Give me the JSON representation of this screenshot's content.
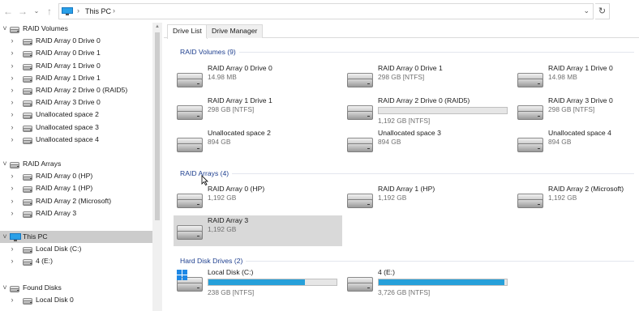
{
  "address_bar": {
    "path": "This PC",
    "back_icon": "arrow-left-icon",
    "forward_icon": "arrow-right-icon",
    "up_icon": "arrow-up-icon",
    "refresh_icon": "refresh-icon"
  },
  "sidebar": {
    "sections": [
      {
        "label": "RAID Volumes",
        "items": [
          "RAID Array 0 Drive 0",
          "RAID Array 0 Drive 1",
          "RAID Array 1 Drive 0",
          "RAID Array 1 Drive 1",
          "RAID Array 2 Drive 0 (RAID5)",
          "RAID Array 3 Drive 0",
          "Unallocated space 2",
          "Unallocated space 3",
          "Unallocated space 4"
        ]
      },
      {
        "label": "RAID Arrays",
        "items": [
          "RAID Array 0 (HP)",
          "RAID Array 1 (HP)",
          "RAID Array 2 (Microsoft)",
          "RAID Array 3"
        ]
      },
      {
        "label": "This PC",
        "items": [
          "Local Disk (C:)",
          "4 (E:)"
        ]
      },
      {
        "label": "Found Disks",
        "items": [
          "Local Disk 0"
        ]
      }
    ]
  },
  "tabs": [
    "Drive List",
    "Drive Manager"
  ],
  "groups": {
    "raid_volumes": {
      "header": "RAID Volumes (9)",
      "tiles": [
        {
          "name": "RAID Array 0 Drive 0",
          "info": "14.98 MB"
        },
        {
          "name": "RAID Array 0 Drive 1",
          "info": "298 GB [NTFS]"
        },
        {
          "name": "RAID Array 1 Drive 0",
          "info": "14.98 MB"
        },
        {
          "name": "RAID Array 1 Drive 1",
          "info": "298 GB [NTFS]"
        },
        {
          "name": "RAID Array 2 Drive 0 (RAID5)",
          "info": "1,192 GB [NTFS]",
          "usage": 0
        },
        {
          "name": "RAID Array 3 Drive 0",
          "info": "298 GB [NTFS]"
        },
        {
          "name": "Unallocated space 2",
          "info": "894 GB"
        },
        {
          "name": "Unallocated space 3",
          "info": "894 GB"
        },
        {
          "name": "Unallocated space 4",
          "info": "894 GB"
        }
      ]
    },
    "raid_arrays": {
      "header": "RAID Arrays (4)",
      "tiles": [
        {
          "name": "RAID Array 0 (HP)",
          "info": "1,192 GB"
        },
        {
          "name": "RAID Array 1 (HP)",
          "info": "1,192 GB"
        },
        {
          "name": "RAID Array 2 (Microsoft)",
          "info": "1,192 GB"
        },
        {
          "name": "RAID Array 3",
          "info": "1,192 GB"
        }
      ]
    },
    "hard_disk_drives": {
      "header": "Hard Disk Drives (2)",
      "tiles": [
        {
          "name": "Local Disk (C:)",
          "info": "238 GB [NTFS]",
          "usage": 0.75
        },
        {
          "name": "4 (E:)",
          "info": "3,726 GB [NTFS]",
          "usage": 0.98
        }
      ]
    }
  },
  "colors": {
    "accent": "#26a0da",
    "group_header": "#1e3f8f",
    "selection": "#cccccc"
  }
}
